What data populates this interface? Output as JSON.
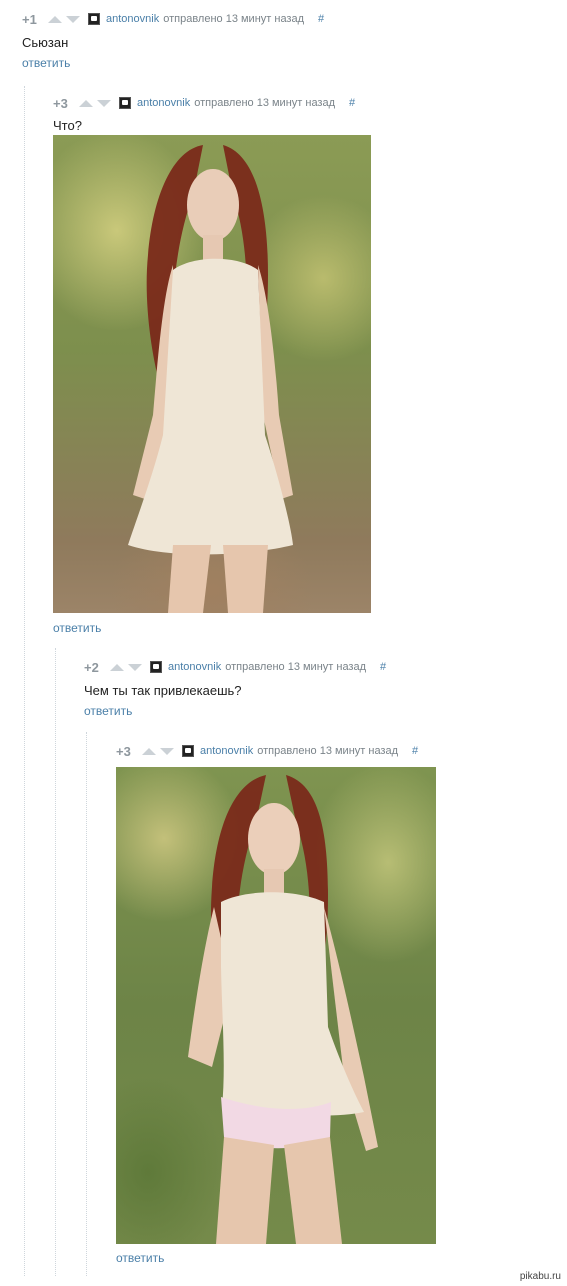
{
  "comments": [
    {
      "rating": "+1",
      "author": "antonovnik",
      "meta": "отправлено 13 минут назад",
      "hash": "#",
      "text": "Сьюзан",
      "reply": "ответить"
    },
    {
      "rating": "+3",
      "author": "antonovnik",
      "meta": "отправлено 13 минут назад",
      "hash": "#",
      "text": "Что?",
      "reply": "ответить"
    },
    {
      "rating": "+2",
      "author": "antonovnik",
      "meta": "отправлено 13 минут назад",
      "hash": "#",
      "text": "Чем ты так привлекаешь?",
      "reply": "ответить"
    },
    {
      "rating": "+3",
      "author": "antonovnik",
      "meta": "отправлено 13 минут назад",
      "hash": "#",
      "text": "",
      "reply": "ответить"
    }
  ],
  "watermark": "pikabu.ru",
  "colors": {
    "link": "#4a7fa8",
    "rating": "#8e979e",
    "thread_line": "#cfd6dc"
  }
}
